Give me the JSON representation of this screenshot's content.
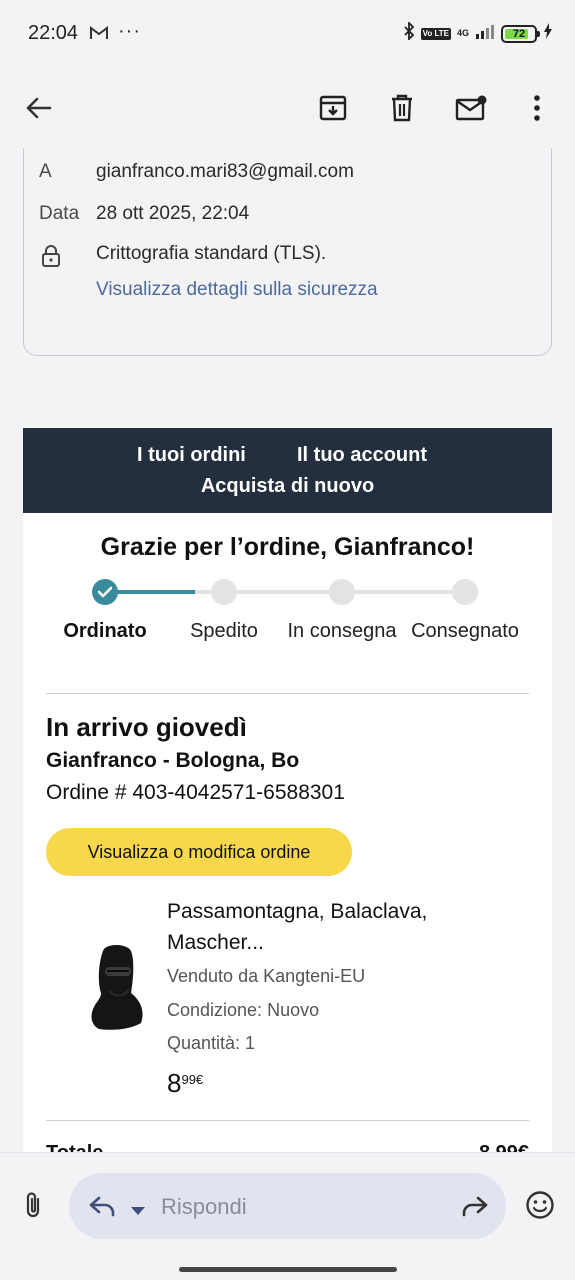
{
  "status_bar": {
    "time": "22:04",
    "dots": "···",
    "network": "4G",
    "volte": "Vo LTE",
    "battery": "72"
  },
  "header": {
    "to_label": "A",
    "to_value": "gianfranco.mari83@gmail.com",
    "date_label": "Data",
    "date_value": "28 ott 2025, 22:04",
    "security_value": "Crittografia standard (TLS).",
    "security_link": "Visualizza dettagli sulla sicurezza"
  },
  "email": {
    "nav": {
      "orders": "I tuoi ordini",
      "account": "Il tuo account",
      "buy_again": "Acquista di nuovo"
    },
    "thanks": "Grazie per l’ordine, Gianfranco!",
    "steps": [
      {
        "label": "Ordinato"
      },
      {
        "label": "Spedito"
      },
      {
        "label": "In consegna"
      },
      {
        "label": "Consegnato"
      }
    ],
    "progress": 0.25,
    "arrival": "In arrivo giovedì",
    "address": "Gianfranco - Bologna, Bo",
    "order_number": "Ordine # 403-4042571-6588301",
    "view_button": "Visualizza o modifica ordine",
    "product": {
      "title": "Passamontagna, Balaclava, Mascher...",
      "seller": "Venduto da Kangteni-EU",
      "condition": "Condizione: Nuovo",
      "quantity": "Quantità: 1",
      "price_main": "8",
      "price_cents": "99€"
    },
    "total_label": "Totale",
    "total_value": "8,99€"
  },
  "reply": {
    "placeholder": "Rispondi"
  }
}
